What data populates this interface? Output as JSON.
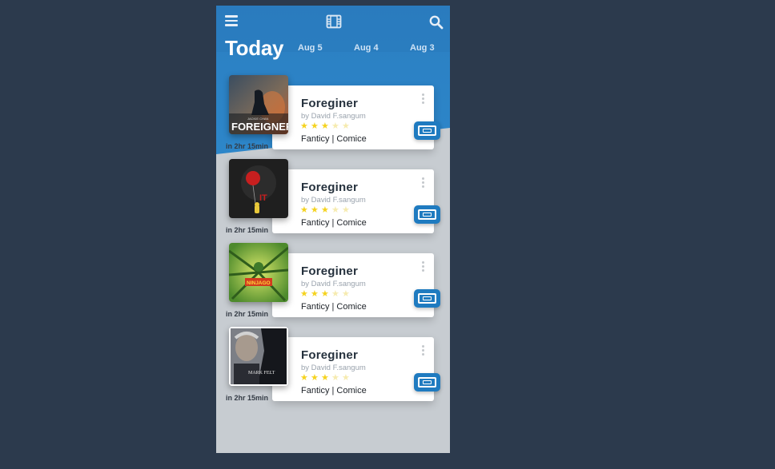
{
  "header": {
    "menu_icon": "hamburger-menu-icon",
    "logo_icon": "film-icon",
    "search_icon": "search-icon"
  },
  "dates": {
    "today_label": "Today",
    "items": [
      "Aug 5",
      "Aug 4",
      "Aug 3"
    ]
  },
  "movies": [
    {
      "title": "Foreginer",
      "author": "by David F.sangum",
      "rating": 3,
      "max_rating": 5,
      "genre": "Fanticy | Comice",
      "duration": "in 2hr 15min",
      "poster": "The Foreigner poster"
    },
    {
      "title": "Foreginer",
      "author": "by David F.sangum",
      "rating": 3,
      "max_rating": 5,
      "genre": "Fanticy | Comice",
      "duration": "in 2hr 15min",
      "poster": "It poster"
    },
    {
      "title": "Foreginer",
      "author": "by David F.sangum",
      "rating": 3,
      "max_rating": 5,
      "genre": "Fanticy | Comice",
      "duration": "in 2hr 15min",
      "poster": "Lego Ninjago poster"
    },
    {
      "title": "Foreginer",
      "author": "by David F.sangum",
      "rating": 3,
      "max_rating": 5,
      "genre": "Fanticy | Comice",
      "duration": "in 2hr 15min",
      "poster": "Mark Felt poster"
    }
  ],
  "poster_texts": {
    "p1_actor": "JACKIE CHAN",
    "p1_title": "FOREIGNER",
    "p2_title": "IT",
    "p3_title": "NINJAGO",
    "p4_title": "MARK FELT"
  },
  "colors": {
    "background": "#2c3a4d",
    "header_blue": "#2a80c4",
    "ticket_blue": "#1f7bc0",
    "star": "#f5d31f",
    "star_empty": "#f6ebb0"
  }
}
